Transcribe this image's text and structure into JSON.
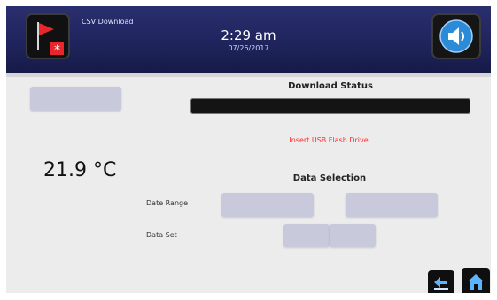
{
  "header": {
    "app_title": "CSV Download",
    "time": "2:29 am",
    "date": "07/26/2017"
  },
  "left": {
    "top_button_label": "",
    "temperature": "21.9 °C"
  },
  "download": {
    "title": "Download Status",
    "progress_percent": 0,
    "status_message": "Insert USB Flash Drive"
  },
  "data_selection": {
    "title": "Data Selection",
    "date_range_label": "Date Range",
    "date_start_value": "",
    "date_end_value": "",
    "data_set_label": "Data Set",
    "data_set_option_1": "",
    "data_set_option_2": ""
  },
  "colors": {
    "header_bg": "#1f245d",
    "warning": "#ff2a2a",
    "disabled_button": "#c9c9dc",
    "accent_blue": "#2c8bd6"
  },
  "icons": {
    "alarm": "red-flag-alarm-icon",
    "sound": "speaker-icon",
    "back": "back-arrow-icon",
    "home": "home-icon"
  }
}
